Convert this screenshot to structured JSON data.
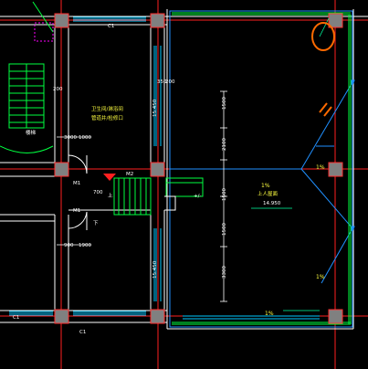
{
  "colors": {
    "background": "#000000",
    "axis": "#ff2020",
    "wall": "#ffffff",
    "column_fill": "#808080",
    "column_border": "#ff3030",
    "window": "#00c8ff",
    "door_stair": "#00ff40",
    "dimension": "#ffffff",
    "text": "#ffff40",
    "roof": "#2090ff",
    "slope": "#00ffa0",
    "annotation": "#ff6a00",
    "magenta": "#ff00ff"
  },
  "labels": {
    "room_a_line1": "卫生间/淋浴间",
    "room_a_line2": "管道井/检修口",
    "roof_slope_pct": "1%",
    "roof_area_label": "上人屋面",
    "roof_elev": "14.950",
    "room_tag_top": "15.450",
    "room_tag_mid": "15.450",
    "door_tag_a": "M1",
    "door_tag_b": "M1",
    "door_tag_c": "M2",
    "win_top": "C1",
    "win_bottom_left": "C1",
    "win_bottom_mid": "C1",
    "dim_a": "3000",
    "dim_b": "1000",
    "dim_c": "700",
    "dim_d": "200",
    "dim_e": "200",
    "dim_f": "350",
    "dim_g": "900",
    "dim_h": "1500",
    "dim_i": "2100",
    "dim_j": "1500",
    "dim_k": "1900",
    "dim_l": "1500",
    "dim_m": "3300",
    "stair_dn": "下",
    "stair_up": "上",
    "mark_cross": "+/-",
    "floor_label": "楼梯",
    "slope_mark_top": "1%",
    "slope_mark_mid": "1%",
    "slope_mark_bot": "1%"
  },
  "icons": {
    "red_arrow": "triangle-marker",
    "orange_circle": "hand-drawn-circle",
    "orange_marks": "hand-drawn-strokes"
  }
}
